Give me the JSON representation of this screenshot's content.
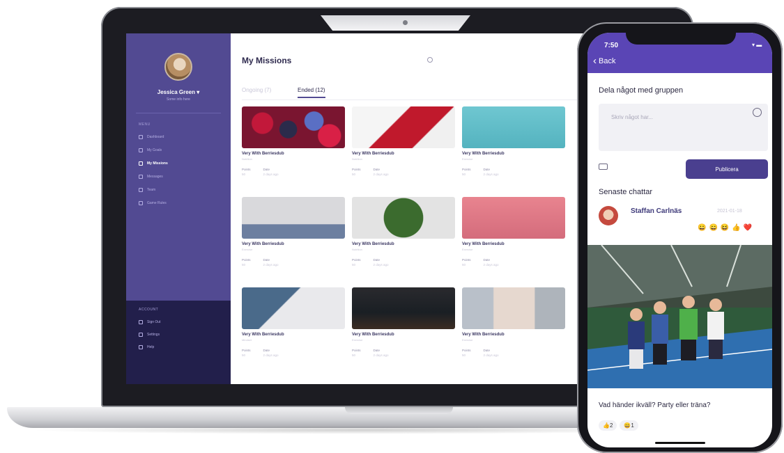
{
  "laptop": {
    "sidebar": {
      "user_name": "Jessica Green ▾",
      "user_sub": "Some info here",
      "menu_heading": "MENU",
      "items": [
        {
          "label": "Dashboard",
          "icon": "grid-icon",
          "active": false
        },
        {
          "label": "My Goals",
          "icon": "target-icon",
          "active": false
        },
        {
          "label": "My Missions",
          "icon": "clipboard-icon",
          "active": true
        },
        {
          "label": "Messages",
          "icon": "chat-icon",
          "active": false
        },
        {
          "label": "Team",
          "icon": "team-icon",
          "active": false
        },
        {
          "label": "Game Rules",
          "icon": "book-icon",
          "active": false
        }
      ],
      "account_heading": "ACCOUNT",
      "account_items": [
        {
          "label": "Sign Out",
          "icon": "signout-icon"
        },
        {
          "label": "Settings",
          "icon": "gear-icon"
        },
        {
          "label": "Help",
          "icon": "help-icon"
        }
      ]
    },
    "main": {
      "title": "My Missions",
      "tabs": [
        {
          "label": "Ongoing (7)",
          "active": false
        },
        {
          "label": "Ended (12)",
          "active": true
        }
      ],
      "cards": [
        {
          "title": "Very With Berriesdub",
          "sub": "Nutrition",
          "points_label": "Points",
          "points": "50",
          "date_label": "Date",
          "date": "2 days ago",
          "image": "berries"
        },
        {
          "title": "Very With Berriesdub",
          "sub": "Nutrition",
          "points_label": "Points",
          "points": "50",
          "date_label": "Date",
          "date": "2 days ago",
          "image": "drink"
        },
        {
          "title": "Very With Berriesdub",
          "sub": "Exercise",
          "points_label": "Points",
          "points": "50",
          "date_label": "Date",
          "date": "2 days ago",
          "image": "stretch"
        },
        {
          "title": "Very With Berriesdub",
          "sub": "Exercise",
          "points_label": "Points",
          "points": "50",
          "date_label": "Date",
          "date": "2 days ago",
          "image": "yoga"
        },
        {
          "title": "Very With Berriesdub",
          "sub": "Nutrition",
          "points_label": "Points",
          "points": "50",
          "date_label": "Date",
          "date": "2 days ago",
          "image": "salad"
        },
        {
          "title": "Very With Berriesdub",
          "sub": "Exercise",
          "points_label": "Points",
          "points": "50",
          "date_label": "Date",
          "date": "2 days ago",
          "image": "pink"
        },
        {
          "title": "Very With Berriesdub",
          "sub": "Mindset",
          "points_label": "Points",
          "points": "50",
          "date_label": "Date",
          "date": "2 days ago",
          "image": "writing"
        },
        {
          "title": "Very With Berriesdub",
          "sub": "Exercise",
          "points_label": "Points",
          "points": "50",
          "date_label": "Date",
          "date": "2 days ago",
          "image": "boxing"
        },
        {
          "title": "Very With Berriesdub",
          "sub": "Exercise",
          "points_label": "Points",
          "points": "50",
          "date_label": "Date",
          "date": "2 days ago",
          "image": "gym"
        }
      ]
    }
  },
  "phone": {
    "time": "7:50",
    "status": "▾ ▬",
    "back_label": "Back",
    "share_heading": "Dela något med gruppen",
    "input_placeholder": "Skriv något har...",
    "publish_label": "Publicera",
    "recent_heading": "Senaste chattar",
    "chat": {
      "name": "Staffan Carlnäs",
      "date": "2021-01-18",
      "reactions": [
        "😀",
        "😄",
        "😆",
        "👍",
        "❤️"
      ]
    },
    "caption": "Vad händer ikväll? Party eller träna?",
    "bubbles": [
      {
        "emoji": "👍",
        "count": "2"
      },
      {
        "emoji": "😄",
        "count": "1"
      }
    ]
  }
}
